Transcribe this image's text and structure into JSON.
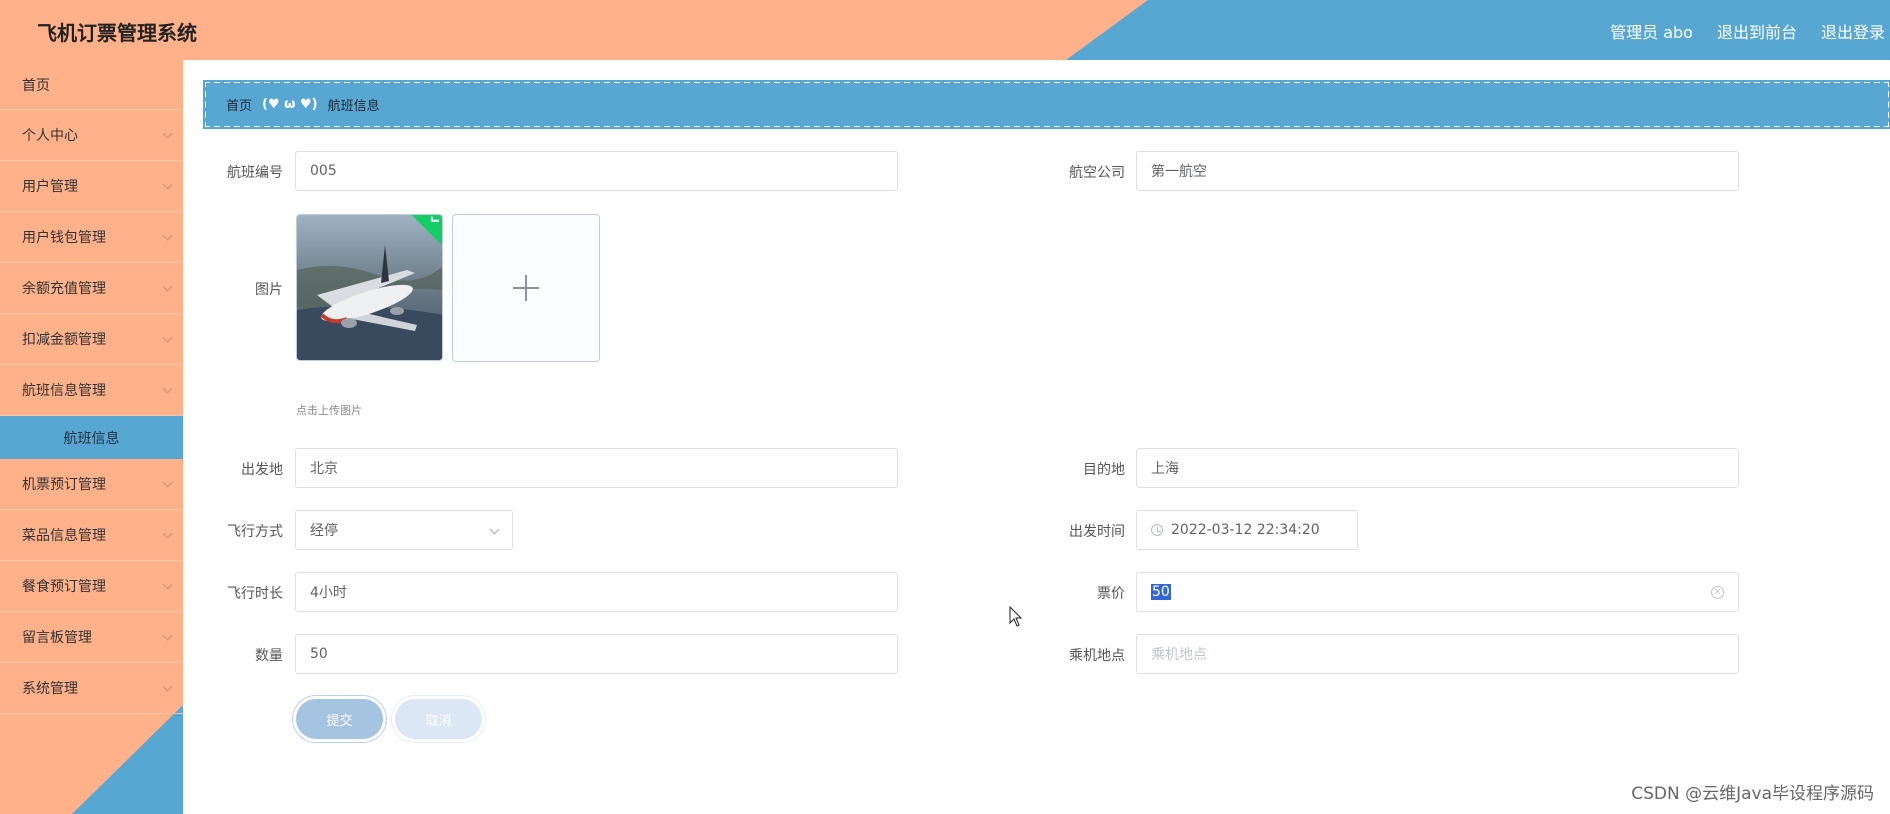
{
  "header": {
    "title": "飞机订票管理系统",
    "admin_label": "管理员 abo",
    "back_to_front": "退出到前台",
    "logout": "退出登录"
  },
  "sidebar": {
    "home": "首页",
    "items": [
      {
        "label": "个人中心"
      },
      {
        "label": "用户管理"
      },
      {
        "label": "用户钱包管理"
      },
      {
        "label": "余额充值管理"
      },
      {
        "label": "扣减金额管理"
      },
      {
        "label": "航班信息管理"
      }
    ],
    "active_sub": "航班信息",
    "items_after": [
      {
        "label": "机票预订管理"
      },
      {
        "label": "菜品信息管理"
      },
      {
        "label": "餐食预订管理"
      },
      {
        "label": "留言板管理"
      },
      {
        "label": "系统管理"
      }
    ]
  },
  "breadcrumb": {
    "home": "首页",
    "separator": "(♥ ω ♥)",
    "current": "航班信息"
  },
  "form": {
    "flight_no": {
      "label": "航班编号",
      "value": "005"
    },
    "airline": {
      "label": "航空公司",
      "value": "第一航空"
    },
    "image": {
      "label": "图片",
      "tip": "点击上传图片"
    },
    "origin": {
      "label": "出发地",
      "value": "北京"
    },
    "destination": {
      "label": "目的地",
      "value": "上海"
    },
    "flight_mode": {
      "label": "飞行方式",
      "value": "经停"
    },
    "departure_time": {
      "label": "出发时间",
      "value": "2022-03-12 22:34:20"
    },
    "duration": {
      "label": "飞行时长",
      "value": "4小时"
    },
    "price": {
      "label": "票价",
      "value": "50"
    },
    "quantity": {
      "label": "数量",
      "value": "50"
    },
    "boarding_place": {
      "label": "乘机地点",
      "placeholder": "乘机地点"
    },
    "submit": "提交",
    "cancel": "取消"
  },
  "watermark": "CSDN @云维Java毕设程序源码",
  "colors": {
    "orange": "#ffb18a",
    "blue": "#58a7d3",
    "success": "#13ce66"
  }
}
